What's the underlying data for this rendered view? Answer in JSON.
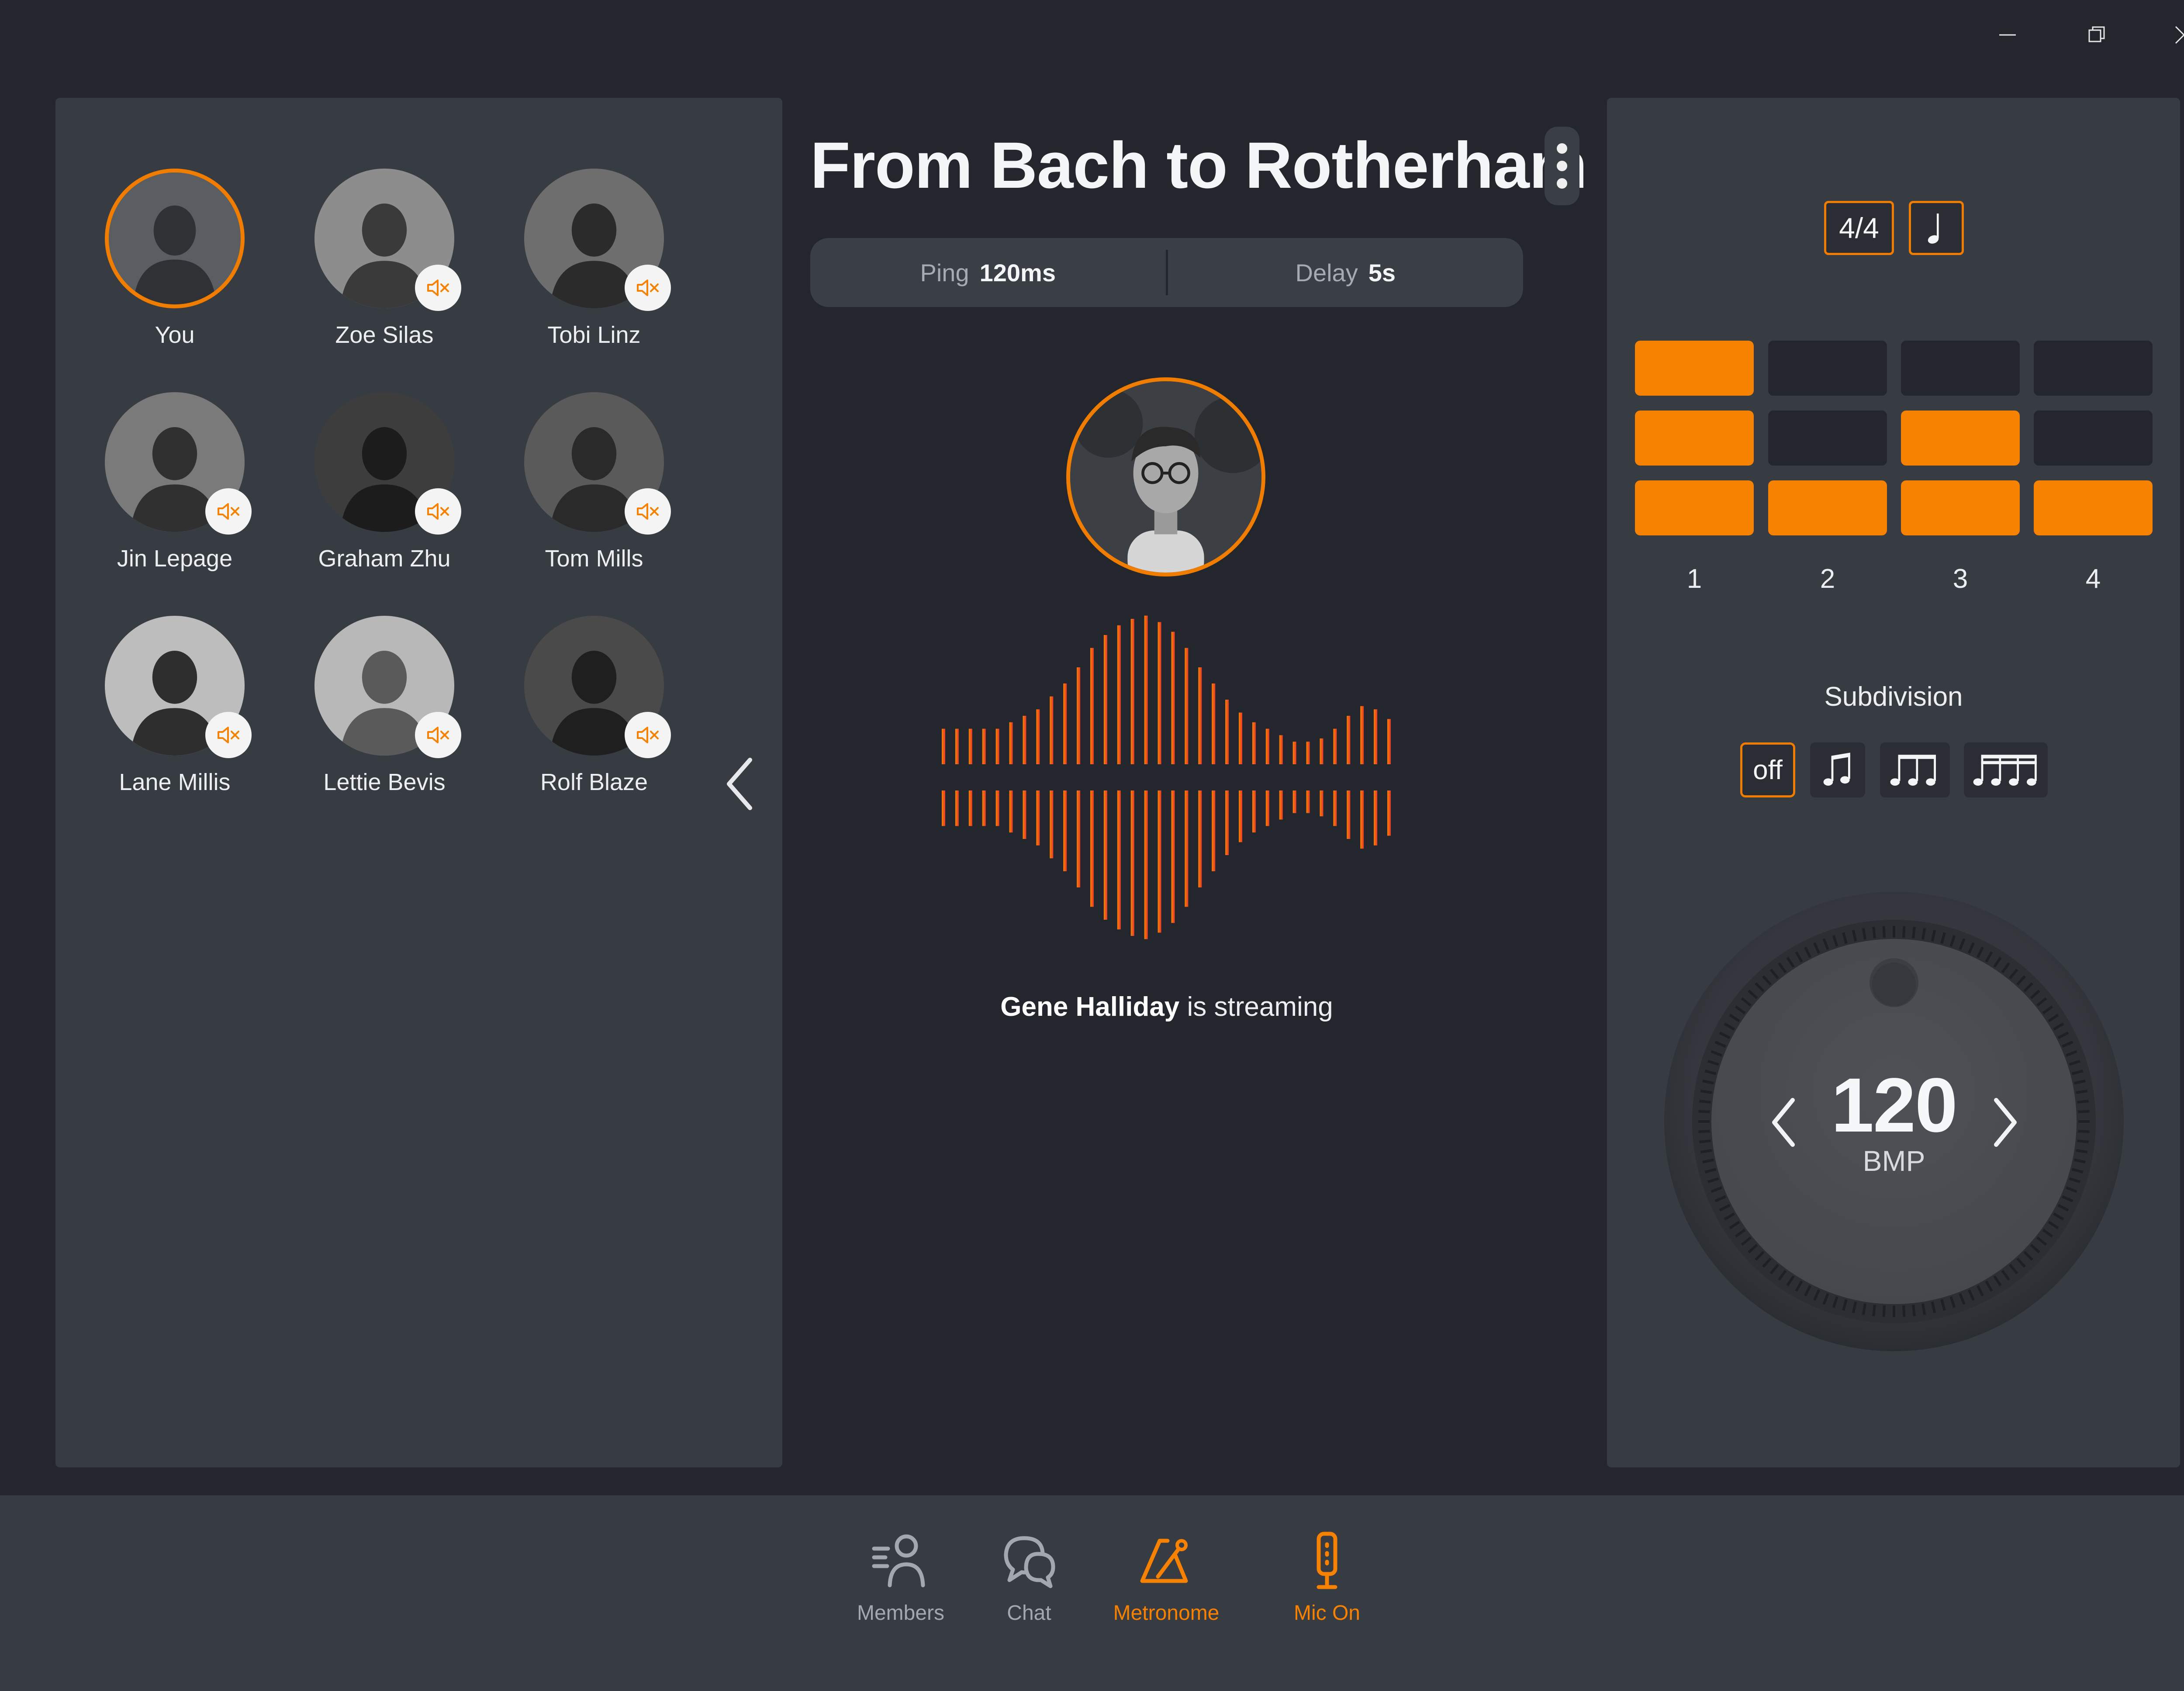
{
  "window": {
    "controls": [
      "minimize",
      "restore",
      "close"
    ]
  },
  "room": {
    "title": "From Bach to Rotherham"
  },
  "stats": {
    "ping_label": "Ping",
    "ping_value": "120ms",
    "delay_label": "Delay",
    "delay_value": "5s"
  },
  "members": [
    {
      "name": "You",
      "muted": false,
      "highlight": true
    },
    {
      "name": "Zoe Silas",
      "muted": true
    },
    {
      "name": "Tobi Linz",
      "muted": true
    },
    {
      "name": "Jin Lepage",
      "muted": true
    },
    {
      "name": "Graham Zhu",
      "muted": true
    },
    {
      "name": "Tom Mills",
      "muted": true
    },
    {
      "name": "Lane Millis",
      "muted": true
    },
    {
      "name": "Lettie Bevis",
      "muted": true
    },
    {
      "name": "Rolf Blaze",
      "muted": true
    }
  ],
  "stream": {
    "streamer": "Gene Halliday",
    "suffix": " is streaming"
  },
  "metronome": {
    "time_signature": "4/4",
    "note_value_icon": "quarter-note-icon",
    "beat_numbers": [
      "1",
      "2",
      "3",
      "4"
    ],
    "beat_grid": [
      [
        1,
        0,
        0,
        0
      ],
      [
        1,
        0,
        1,
        0
      ],
      [
        1,
        1,
        1,
        1
      ]
    ],
    "subdivision_label": "Subdivision",
    "subdivision_off": "off",
    "subdivision_options": [
      "off",
      "eighth-notes-icon",
      "triplet-notes-icon",
      "sixteenth-notes-icon"
    ],
    "subdivision_selected": "off",
    "bpm_value": "120",
    "bpm_unit": "BMP"
  },
  "nav": [
    {
      "label": "Members",
      "icon": "members-icon",
      "active": false
    },
    {
      "label": "Chat",
      "icon": "chat-icon",
      "active": false
    },
    {
      "label": "Metronome",
      "icon": "metronome-icon",
      "active": true
    },
    {
      "label": "Mic On",
      "icon": "microphone-icon",
      "active": true
    }
  ],
  "colors": {
    "accent": "#f78100",
    "background": "#23262d",
    "panel": "#373b42",
    "wave_start": "#f78100",
    "wave_end": "#e8392b"
  }
}
